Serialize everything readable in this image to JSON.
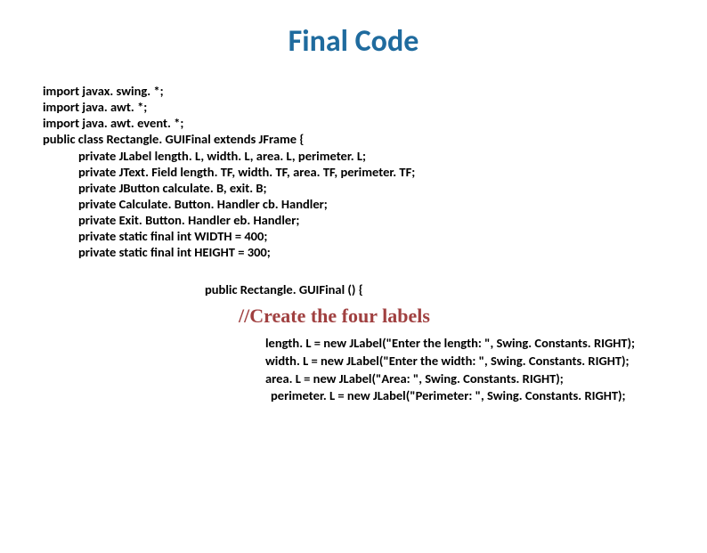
{
  "title": "Final Code",
  "code": {
    "l0": "import javax. swing. *;",
    "l1": "import java. awt. *;",
    "l2": "import java. awt. event. *;",
    "l3": "public class Rectangle. GUIFinal  extends JFrame {",
    "l4": "private JLabel length. L, width. L, area. L, perimeter. L;",
    "l5": "private JText. Field length. TF, width. TF, area. TF, perimeter. TF;",
    "l6": "private JButton calculate. B, exit. B;",
    "l7": "private Calculate. Button. Handler cb. Handler;",
    "l8": "private Exit. Button. Handler eb. Handler;",
    "l9": "private static final int WIDTH = 400;",
    "l10": "private static final int HEIGHT = 300;"
  },
  "constructor": "public Rectangle. GUIFinal () {",
  "comment": "//Create the four labels",
  "labels": {
    "ll0": "length. L = new JLabel(\"Enter the length: \", Swing. Constants. RIGHT);",
    "ll1": "width. L = new JLabel(\"Enter the width: \", Swing. Constants. RIGHT);",
    "ll2": "area. L = new JLabel(\"Area: \", Swing. Constants. RIGHT);",
    "ll3": " perimeter. L = new JLabel(\"Perimeter: \", Swing. Constants. RIGHT);"
  }
}
